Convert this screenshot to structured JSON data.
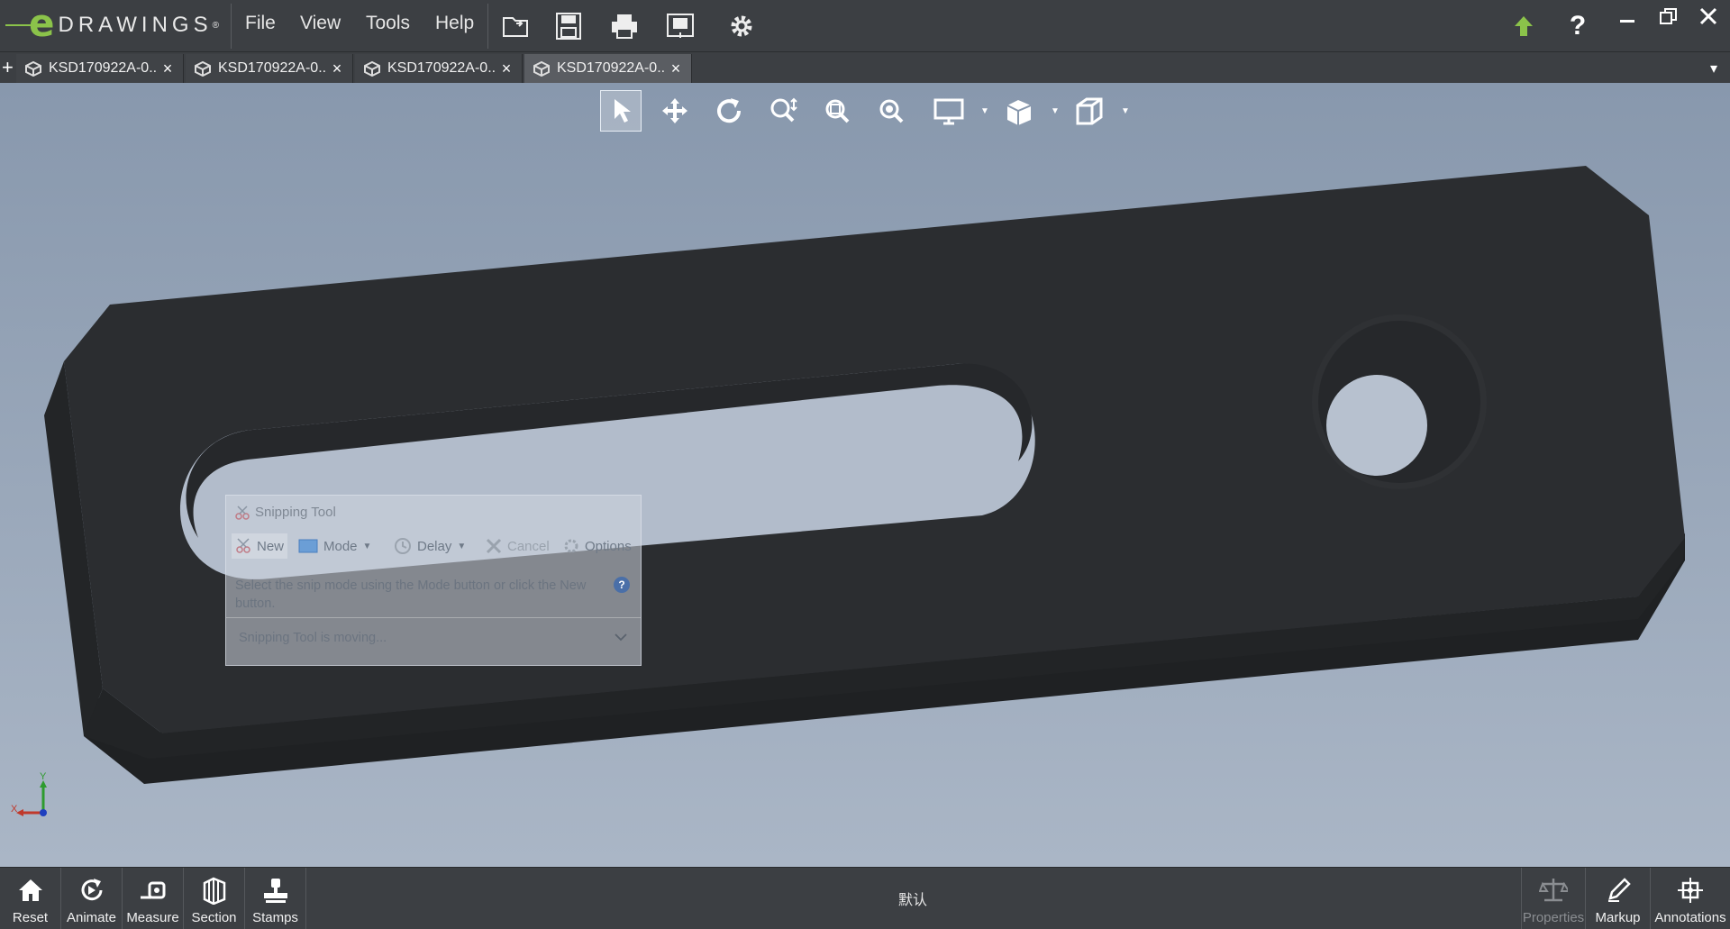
{
  "app": {
    "logo_letter": "e",
    "logo_word": "DRAWINGS",
    "logo_reg": "®",
    "accent_color": "#8bc34a"
  },
  "menu": {
    "items": [
      "File",
      "View",
      "Tools",
      "Help"
    ]
  },
  "toolbar_icons": [
    "open-icon",
    "save-icon",
    "print-icon",
    "publish-icon",
    "settings-icon"
  ],
  "title_right_icons": [
    "update-arrow-icon",
    "help-icon",
    "minimize-icon",
    "restore-icon",
    "close-icon"
  ],
  "tabs": [
    {
      "label": "KSD170922A-0...",
      "close": "×"
    },
    {
      "label": "KSD170922A-0...",
      "close": "×"
    },
    {
      "label": "KSD170922A-0...",
      "close": "×"
    },
    {
      "label": "KSD170922A-0...",
      "close": "×"
    }
  ],
  "active_tab_index": 3,
  "tabbar": {
    "add": "+",
    "dropdown": "▾"
  },
  "view_tools": [
    "select-icon",
    "pan-icon",
    "rotate-icon",
    "zoom-icon",
    "zoom-to-area-icon",
    "zoom-to-fit-icon",
    "display-style-icon",
    "shaded-icon",
    "standard-views-icon"
  ],
  "triad": {
    "x": "X",
    "y": "Y"
  },
  "snipping_tool": {
    "title": "Snipping Tool",
    "buttons": {
      "new": "New",
      "mode": "Mode",
      "delay": "Delay",
      "cancel": "Cancel",
      "options": "Options"
    },
    "description": "Select the snip mode using the Mode button or click the New button.",
    "status": "Snipping Tool is moving...",
    "help": "?"
  },
  "bottom": {
    "left_buttons": [
      {
        "label": "Reset",
        "icon": "home-icon"
      },
      {
        "label": "Animate",
        "icon": "animate-icon"
      },
      {
        "label": "Measure",
        "icon": "measure-icon"
      },
      {
        "label": "Section",
        "icon": "section-icon"
      },
      {
        "label": "Stamps",
        "icon": "stamps-icon"
      }
    ],
    "config": "默认",
    "right_buttons": [
      {
        "label": "Properties",
        "icon": "properties-icon",
        "enabled": false
      },
      {
        "label": "Markup",
        "icon": "markup-icon",
        "enabled": true
      },
      {
        "label": "Annotations",
        "icon": "annotations-icon",
        "enabled": true
      }
    ]
  },
  "colors": {
    "chrome": "#3c3f43",
    "part": "#2c2e31",
    "viewport_top": "#8898ad",
    "viewport_bottom": "#aab6c6"
  }
}
